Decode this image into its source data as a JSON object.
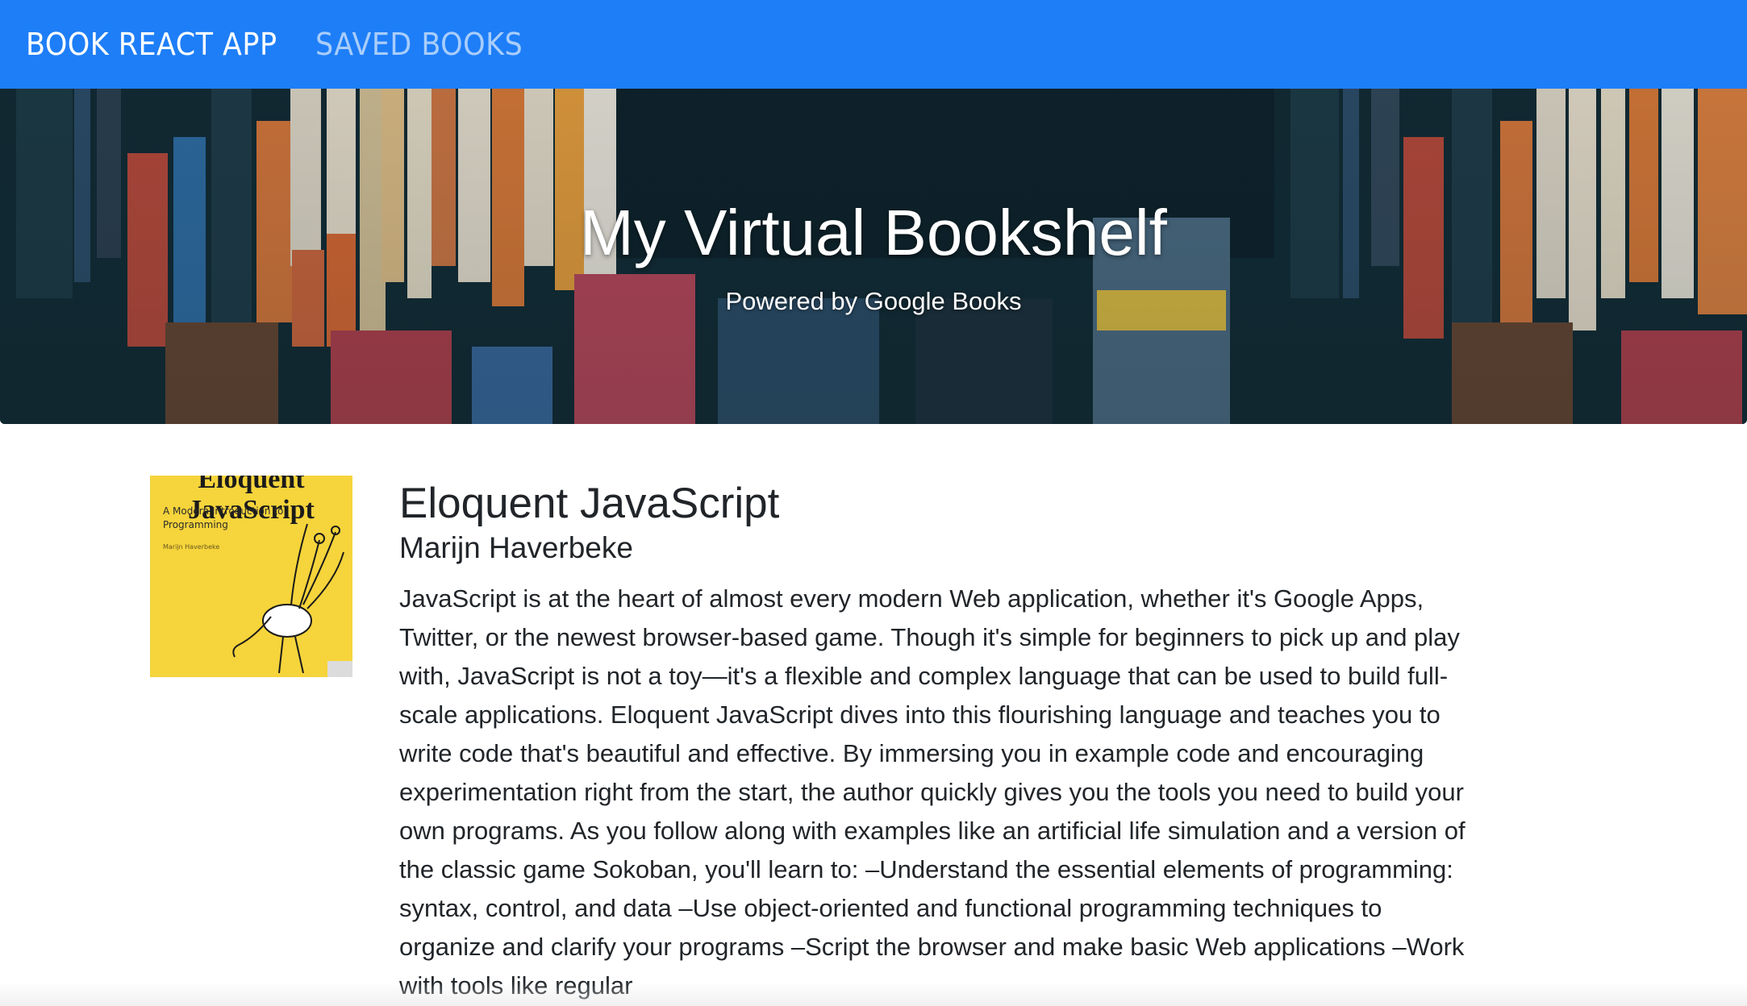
{
  "navbar": {
    "brand": "BOOK REACT APP",
    "saved_link": "SAVED BOOKS",
    "bg_color": "#1e7ef7"
  },
  "hero": {
    "title": "My Virtual Bookshelf",
    "subtitle": "Powered by Google Books"
  },
  "book": {
    "title": "Eloquent JavaScript",
    "author": "Marijn Haverbeke",
    "cover": {
      "title": "Eloquent JavaScript",
      "subtitle": "A Modern Introduction to Programming",
      "author": "Marijn Haverbeke"
    },
    "description": "JavaScript is at the heart of almost every modern Web application, whether it's Google Apps, Twitter, or the newest browser-based game. Though it's simple for beginners to pick up and play with, JavaScript is not a toy—it's a flexible and complex language that can be used to build full-scale applications. Eloquent JavaScript dives into this flourishing language and teaches you to write code that's beautiful and effective. By immersing you in example code and encouraging experimentation right from the start, the author quickly gives you the tools you need to build your own programs. As you follow along with examples like an artificial life simulation and a version of the classic game Sokoban, you'll learn to: –Understand the essential elements of programming: syntax, control, and data –Use object-oriented and functional programming techniques to organize and clarify your programs –Script the browser and make basic Web applications –Work with tools like regular"
  }
}
